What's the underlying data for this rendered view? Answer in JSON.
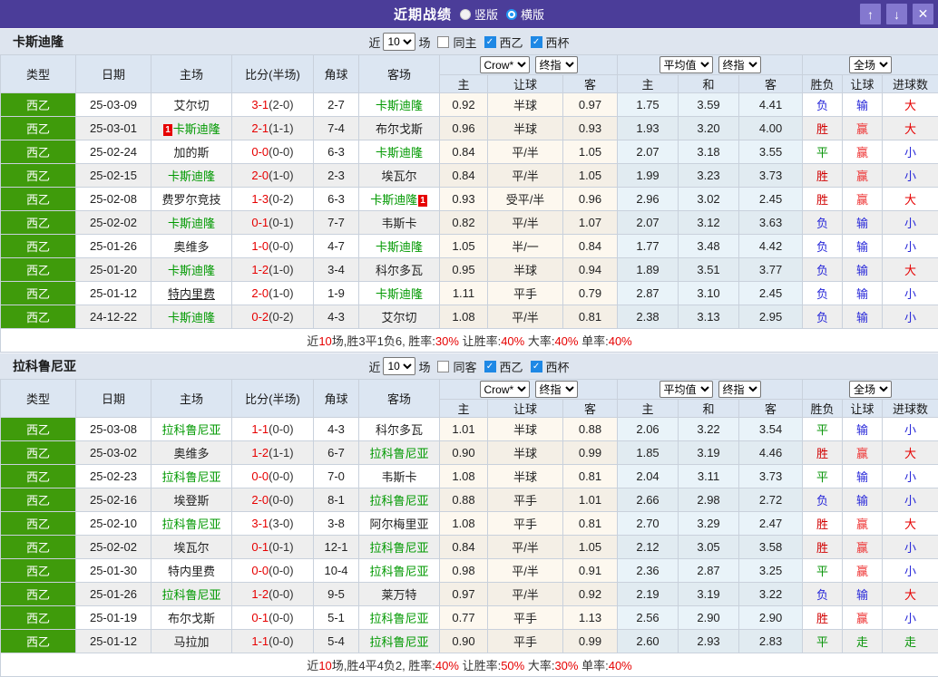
{
  "titlebar": {
    "title": "近期战绩",
    "radio_vertical": "竖版",
    "radio_horizontal": "横版"
  },
  "icons": {
    "arrow_up": "↑",
    "arrow_down": "↓",
    "close": "✕",
    "check": "✓"
  },
  "ui": {
    "near": "近",
    "games": "场",
    "league_label": "西乙",
    "cup_label": "西杯"
  },
  "header": {
    "col_type": "类型",
    "col_date": "日期",
    "col_home": "主场",
    "col_score": "比分(半场)",
    "col_corner": "角球",
    "col_away": "客场",
    "dd_company": "Crow*",
    "dd_final": "终指",
    "dd_avg": "平均值",
    "dd_fulltime": "全场",
    "sub": [
      "主",
      "让球",
      "客",
      "主",
      "和",
      "客",
      "胜负",
      "让球",
      "进球数"
    ]
  },
  "colors": {
    "titlebar": "#4b3d99",
    "titlebar_button": "#8478cf",
    "league_cell": "#3f9b0b",
    "focal_team": "#009900",
    "score": "#e60000",
    "checked_checkbox": "#1e88e5"
  },
  "result_colors": {
    "胜": "#d10000",
    "赢": "#e33",
    "大": "#e60000",
    "平": "#089408",
    "走": "#089408",
    "负": "#2727d9",
    "输": "#2727d9",
    "小": "#2727d9"
  },
  "sections": [
    {
      "team": "卡斯迪隆",
      "filter": {
        "count": "10",
        "same_label": "同主",
        "same_checked": false,
        "league_checked": true,
        "cup_checked": true
      },
      "rows": [
        {
          "league": "西乙",
          "date": "25-03-09",
          "home": {
            "name": "艾尔切"
          },
          "score": "3-1",
          "half": "(2-0)",
          "corner": "2-7",
          "away": {
            "name": "卡斯迪隆",
            "focal": true
          },
          "odds": [
            "0.92",
            "半球",
            "0.97"
          ],
          "avg": [
            "1.75",
            "3.59",
            "4.41"
          ],
          "res": [
            "负",
            "输",
            "大"
          ]
        },
        {
          "league": "西乙",
          "date": "25-03-01",
          "home": {
            "name": "卡斯迪隆",
            "focal": true,
            "badge_before": "1"
          },
          "score": "2-1",
          "half": "(1-1)",
          "corner": "7-4",
          "away": {
            "name": "布尔戈斯"
          },
          "odds": [
            "0.96",
            "半球",
            "0.93"
          ],
          "avg": [
            "1.93",
            "3.20",
            "4.00"
          ],
          "res": [
            "胜",
            "赢",
            "大"
          ]
        },
        {
          "league": "西乙",
          "date": "25-02-24",
          "home": {
            "name": "加的斯"
          },
          "score": "0-0",
          "half": "(0-0)",
          "corner": "6-3",
          "away": {
            "name": "卡斯迪隆",
            "focal": true
          },
          "odds": [
            "0.84",
            "平/半",
            "1.05"
          ],
          "avg": [
            "2.07",
            "3.18",
            "3.55"
          ],
          "res": [
            "平",
            "赢",
            "小"
          ]
        },
        {
          "league": "西乙",
          "date": "25-02-15",
          "home": {
            "name": "卡斯迪隆",
            "focal": true
          },
          "score": "2-0",
          "half": "(1-0)",
          "corner": "2-3",
          "away": {
            "name": "埃瓦尔"
          },
          "odds": [
            "0.84",
            "平/半",
            "1.05"
          ],
          "avg": [
            "1.99",
            "3.23",
            "3.73"
          ],
          "res": [
            "胜",
            "赢",
            "小"
          ]
        },
        {
          "league": "西乙",
          "date": "25-02-08",
          "home": {
            "name": "费罗尔竞技"
          },
          "score": "1-3",
          "half": "(0-2)",
          "corner": "6-3",
          "away": {
            "name": "卡斯迪隆",
            "focal": true,
            "badge_after": "1"
          },
          "odds": [
            "0.93",
            "受平/半",
            "0.96"
          ],
          "avg": [
            "2.96",
            "3.02",
            "2.45"
          ],
          "res": [
            "胜",
            "赢",
            "大"
          ]
        },
        {
          "league": "西乙",
          "date": "25-02-02",
          "home": {
            "name": "卡斯迪隆",
            "focal": true
          },
          "score": "0-1",
          "half": "(0-1)",
          "corner": "7-7",
          "away": {
            "name": "韦斯卡"
          },
          "odds": [
            "0.82",
            "平/半",
            "1.07"
          ],
          "avg": [
            "2.07",
            "3.12",
            "3.63"
          ],
          "res": [
            "负",
            "输",
            "小"
          ]
        },
        {
          "league": "西乙",
          "date": "25-01-26",
          "home": {
            "name": "奥维多"
          },
          "score": "1-0",
          "half": "(0-0)",
          "corner": "4-7",
          "away": {
            "name": "卡斯迪隆",
            "focal": true
          },
          "odds": [
            "1.05",
            "半/一",
            "0.84"
          ],
          "avg": [
            "1.77",
            "3.48",
            "4.42"
          ],
          "res": [
            "负",
            "输",
            "小"
          ]
        },
        {
          "league": "西乙",
          "date": "25-01-20",
          "home": {
            "name": "卡斯迪隆",
            "focal": true
          },
          "score": "1-2",
          "half": "(1-0)",
          "corner": "3-4",
          "away": {
            "name": "科尔多瓦"
          },
          "odds": [
            "0.95",
            "半球",
            "0.94"
          ],
          "avg": [
            "1.89",
            "3.51",
            "3.77"
          ],
          "res": [
            "负",
            "输",
            "大"
          ]
        },
        {
          "league": "西乙",
          "date": "25-01-12",
          "home": {
            "name": "特内里费",
            "underline": true
          },
          "score": "2-0",
          "half": "(1-0)",
          "corner": "1-9",
          "away": {
            "name": "卡斯迪隆",
            "focal": true
          },
          "odds": [
            "1.11",
            "平手",
            "0.79"
          ],
          "avg": [
            "2.87",
            "3.10",
            "2.45"
          ],
          "res": [
            "负",
            "输",
            "小"
          ]
        },
        {
          "league": "西乙",
          "date": "24-12-22",
          "home": {
            "name": "卡斯迪隆",
            "focal": true
          },
          "score": "0-2",
          "half": "(0-2)",
          "corner": "4-3",
          "away": {
            "name": "艾尔切"
          },
          "odds": [
            "1.08",
            "平/半",
            "0.81"
          ],
          "avg": [
            "2.38",
            "3.13",
            "2.95"
          ],
          "res": [
            "负",
            "输",
            "小"
          ]
        }
      ],
      "summary": [
        {
          "t": "近"
        },
        {
          "t": "10",
          "red": true
        },
        {
          "t": "场,胜3平1负6, 胜率:"
        },
        {
          "t": "30%",
          "red": true
        },
        {
          "t": " 让胜率:"
        },
        {
          "t": "40%",
          "red": true
        },
        {
          "t": " 大率:"
        },
        {
          "t": "40%",
          "red": true
        },
        {
          "t": " 单率:"
        },
        {
          "t": "40%",
          "red": true
        }
      ]
    },
    {
      "team": "拉科鲁尼亚",
      "filter": {
        "count": "10",
        "same_label": "同客",
        "same_checked": false,
        "league_checked": true,
        "cup_checked": true
      },
      "rows": [
        {
          "league": "西乙",
          "date": "25-03-08",
          "home": {
            "name": "拉科鲁尼亚",
            "focal": true
          },
          "score": "1-1",
          "half": "(0-0)",
          "corner": "4-3",
          "away": {
            "name": "科尔多瓦"
          },
          "odds": [
            "1.01",
            "半球",
            "0.88"
          ],
          "avg": [
            "2.06",
            "3.22",
            "3.54"
          ],
          "res": [
            "平",
            "输",
            "小"
          ]
        },
        {
          "league": "西乙",
          "date": "25-03-02",
          "home": {
            "name": "奥维多"
          },
          "score": "1-2",
          "half": "(1-1)",
          "corner": "6-7",
          "away": {
            "name": "拉科鲁尼亚",
            "focal": true
          },
          "odds": [
            "0.90",
            "半球",
            "0.99"
          ],
          "avg": [
            "1.85",
            "3.19",
            "4.46"
          ],
          "res": [
            "胜",
            "赢",
            "大"
          ]
        },
        {
          "league": "西乙",
          "date": "25-02-23",
          "home": {
            "name": "拉科鲁尼亚",
            "focal": true
          },
          "score": "0-0",
          "half": "(0-0)",
          "corner": "7-0",
          "away": {
            "name": "韦斯卡"
          },
          "odds": [
            "1.08",
            "半球",
            "0.81"
          ],
          "avg": [
            "2.04",
            "3.11",
            "3.73"
          ],
          "res": [
            "平",
            "输",
            "小"
          ]
        },
        {
          "league": "西乙",
          "date": "25-02-16",
          "home": {
            "name": "埃登斯"
          },
          "score": "2-0",
          "half": "(0-0)",
          "corner": "8-1",
          "away": {
            "name": "拉科鲁尼亚",
            "focal": true
          },
          "odds": [
            "0.88",
            "平手",
            "1.01"
          ],
          "avg": [
            "2.66",
            "2.98",
            "2.72"
          ],
          "res": [
            "负",
            "输",
            "小"
          ]
        },
        {
          "league": "西乙",
          "date": "25-02-10",
          "home": {
            "name": "拉科鲁尼亚",
            "focal": true
          },
          "score": "3-1",
          "half": "(3-0)",
          "corner": "3-8",
          "away": {
            "name": "阿尔梅里亚"
          },
          "odds": [
            "1.08",
            "平手",
            "0.81"
          ],
          "avg": [
            "2.70",
            "3.29",
            "2.47"
          ],
          "res": [
            "胜",
            "赢",
            "大"
          ]
        },
        {
          "league": "西乙",
          "date": "25-02-02",
          "home": {
            "name": "埃瓦尔"
          },
          "score": "0-1",
          "half": "(0-1)",
          "corner": "12-1",
          "away": {
            "name": "拉科鲁尼亚",
            "focal": true
          },
          "odds": [
            "0.84",
            "平/半",
            "1.05"
          ],
          "avg": [
            "2.12",
            "3.05",
            "3.58"
          ],
          "res": [
            "胜",
            "赢",
            "小"
          ]
        },
        {
          "league": "西乙",
          "date": "25-01-30",
          "home": {
            "name": "特内里费"
          },
          "score": "0-0",
          "half": "(0-0)",
          "corner": "10-4",
          "away": {
            "name": "拉科鲁尼亚",
            "focal": true
          },
          "odds": [
            "0.98",
            "平/半",
            "0.91"
          ],
          "avg": [
            "2.36",
            "2.87",
            "3.25"
          ],
          "res": [
            "平",
            "赢",
            "小"
          ]
        },
        {
          "league": "西乙",
          "date": "25-01-26",
          "home": {
            "name": "拉科鲁尼亚",
            "focal": true
          },
          "score": "1-2",
          "half": "(0-0)",
          "corner": "9-5",
          "away": {
            "name": "莱万特"
          },
          "odds": [
            "0.97",
            "平/半",
            "0.92"
          ],
          "avg": [
            "2.19",
            "3.19",
            "3.22"
          ],
          "res": [
            "负",
            "输",
            "大"
          ]
        },
        {
          "league": "西乙",
          "date": "25-01-19",
          "home": {
            "name": "布尔戈斯"
          },
          "score": "0-1",
          "half": "(0-0)",
          "corner": "5-1",
          "away": {
            "name": "拉科鲁尼亚",
            "focal": true
          },
          "odds": [
            "0.77",
            "平手",
            "1.13"
          ],
          "avg": [
            "2.56",
            "2.90",
            "2.90"
          ],
          "res": [
            "胜",
            "赢",
            "小"
          ]
        },
        {
          "league": "西乙",
          "date": "25-01-12",
          "home": {
            "name": "马拉加"
          },
          "score": "1-1",
          "half": "(0-0)",
          "corner": "5-4",
          "away": {
            "name": "拉科鲁尼亚",
            "focal": true
          },
          "odds": [
            "0.90",
            "平手",
            "0.99"
          ],
          "avg": [
            "2.60",
            "2.93",
            "2.83"
          ],
          "res": [
            "平",
            "走",
            "走"
          ]
        }
      ],
      "summary": [
        {
          "t": "近"
        },
        {
          "t": "10",
          "red": true
        },
        {
          "t": "场,胜4平4负2, 胜率:"
        },
        {
          "t": "40%",
          "red": true
        },
        {
          "t": " 让胜率:"
        },
        {
          "t": "50%",
          "red": true
        },
        {
          "t": " 大率:"
        },
        {
          "t": "30%",
          "red": true
        },
        {
          "t": " 单率:"
        },
        {
          "t": "40%",
          "red": true
        }
      ]
    }
  ]
}
